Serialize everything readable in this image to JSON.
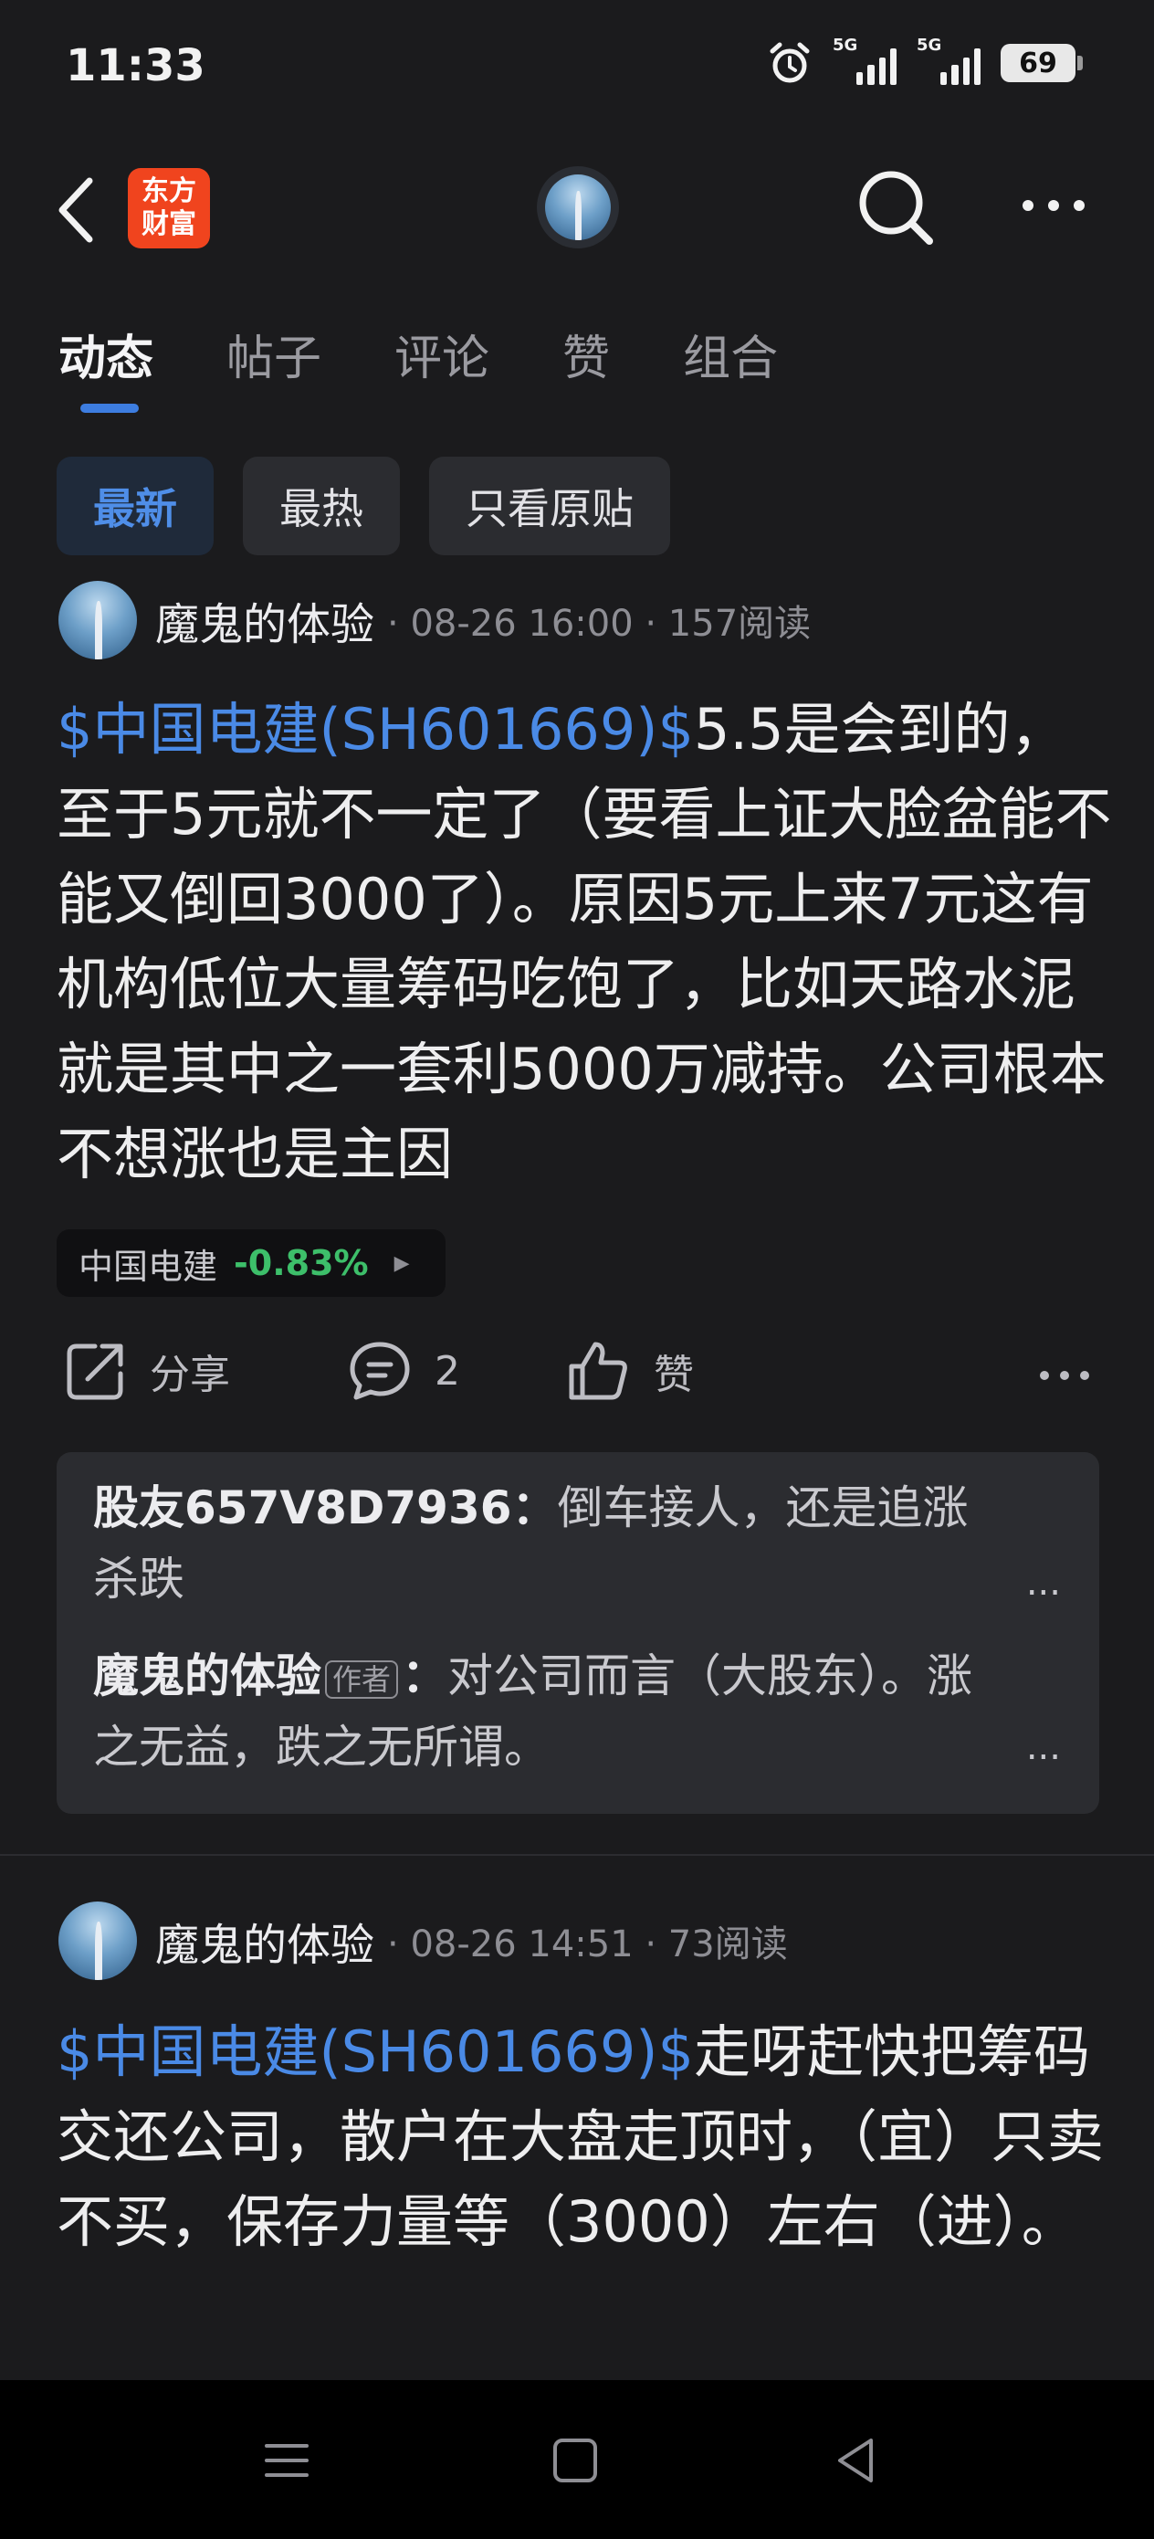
{
  "status_bar": {
    "time": "11:33",
    "signal_1_label": "5G",
    "signal_2_label": "5G",
    "battery": "69"
  },
  "header": {
    "logo_line1": "东方",
    "logo_line2": "财富"
  },
  "tabs": [
    {
      "label": "动态",
      "active": true
    },
    {
      "label": "帖子",
      "active": false
    },
    {
      "label": "评论",
      "active": false
    },
    {
      "label": "赞",
      "active": false
    },
    {
      "label": "组合",
      "active": false
    }
  ],
  "filters": [
    {
      "label": "最新",
      "active": true
    },
    {
      "label": "最热",
      "active": false
    },
    {
      "label": "只看原贴",
      "active": false
    }
  ],
  "posts": [
    {
      "author": "魔鬼的体验",
      "meta": "· 08-26 16:00 · 157阅读",
      "stock_link": "$中国电建(SH601669)$",
      "text": "5.5是会到的，至于5元就不一定了（要看上证大脸盆能不能又倒回3000了）。原因5元上来7元这有机构低位大量筹码吃饱了，比如天路水泥就是其中之一套利5000万减持。公司根本不想涨也是主因",
      "stock_tag": {
        "name": "中国电建",
        "change": "-0.83%"
      },
      "actions": {
        "share": "分享",
        "comment_count": "2",
        "like": "赞"
      },
      "comments": [
        {
          "user": "股友657V8D7936：",
          "text": "倒车接人，还是追涨杀跌",
          "more": "..."
        },
        {
          "user": "魔鬼的体验",
          "badge": "作者",
          "colon": "：",
          "text": "对公司而言（大股东）。涨之无益，跌之无所谓。",
          "more": "..."
        }
      ]
    },
    {
      "author": "魔鬼的体验",
      "meta": "· 08-26 14:51 · 73阅读",
      "stock_link": "$中国电建(SH601669)$",
      "text": "走呀赶快把筹码交还公司，散户在大盘走顶时，（宜）只卖不买，保存力量等（3000）左右（进）。"
    }
  ],
  "colors": {
    "background": "#1b1b1d",
    "accent_blue": "#4a8ae6",
    "up_down_green": "#3dbf6a",
    "logo_red": "#f0441e"
  },
  "icons": [
    "alarm-icon",
    "back-icon",
    "search-icon",
    "more-icon",
    "share-icon",
    "comment-icon",
    "like-icon",
    "menu-nav-icon",
    "home-nav-icon",
    "back-nav-icon"
  ]
}
